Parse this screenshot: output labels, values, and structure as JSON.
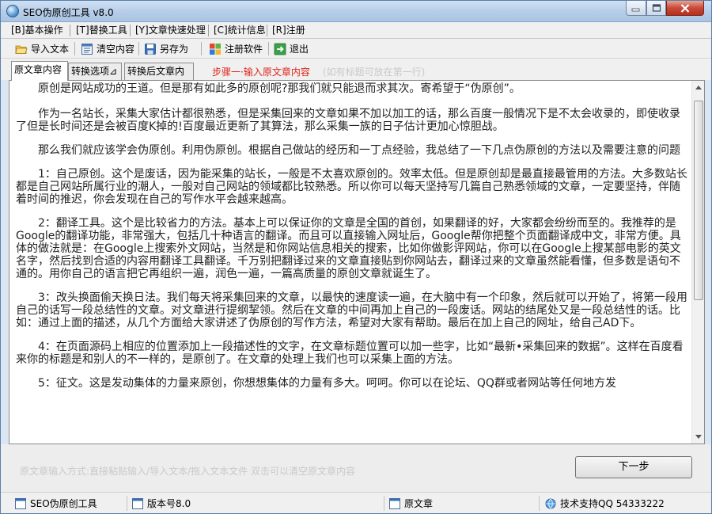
{
  "window": {
    "title": "SEO伪原创工具 v8.0"
  },
  "menu": {
    "items": [
      {
        "label": "[B]基本操作"
      },
      {
        "label": "[T]替换工具"
      },
      {
        "label": "[Y]文章快速处理"
      },
      {
        "label": "[C]统计信息"
      },
      {
        "label": "[R]注册"
      }
    ]
  },
  "toolbar": {
    "import_label": "导入文本",
    "clear_label": "清空内容",
    "save_as_label": "另存为",
    "register_label": "注册软件",
    "exit_label": "退出"
  },
  "tabs": {
    "original": "原文章内容",
    "options": "转换选项⊿",
    "converted": "转换后文章内容"
  },
  "step": {
    "label": "步骤一·输入原文章内容",
    "hint": "(如有标题可放在第一行)"
  },
  "article": {
    "paragraphs": [
      "原创是网站成功的王道。但是那有如此多的原创呢?那我们就只能退而求其次。寄希望于“伪原创”。",
      "作为一名站长，采集大家估计都很熟悉，但是采集回来的文章如果不加以加工的话，那么百度一般情况下是不太会收录的，即使收录了但是长时间还是会被百度K掉的!百度最近更新了其算法，那么采集一族的日子估计更加心惊胆战。",
      "那么我们就应该学会伪原创。利用伪原创。根据自己做站的经历和一丁点经验，我总结了一下几点伪原创的方法以及需要注意的问题",
      "1：自己原创。这个是废话，因为能采集的站长，一般是不太喜欢原创的。效率太低。但是原创却是最直接最管用的方法。大多数站长都是自己网站所属行业的潮人，一般对自己网站的领域都比较熟悉。所以你可以每天坚持写几篇自己熟悉领域的文章，一定要坚持，伴随着时间的推迟，你会发现在自己的写作水平会越来越高。",
      "2：翻译工具。这个是比较省力的方法。基本上可以保证你的文章是全国的首创，如果翻译的好，大家都会纷纷而至的。我推荐的是Google的翻译功能，非常强大，包括几十种语言的翻译。而且可以直接输入网址后，Google帮你把整个页面翻译成中文，非常方便。具体的做法就是：在Google上搜索外文网站，当然是和你网站信息相关的搜索，比如你做影评网站，你可以在Google上搜某部电影的英文名字，然后找到合适的内容用翻译工具翻译。千万别把翻译过来的文章直接贴到你网站去，翻译过来的文章虽然能看懂，但多数是语句不通的。用你自己的语言把它再组织一遍，润色一遍，一篇高质量的原创文章就诞生了。",
      "3：改头换面偷天换日法。我们每天将采集回来的文章，以最快的速度读一遍，在大脑中有一个印象，然后就可以开始了，将第一段用自己的话写一段总结性的文章。对文章进行提纲挈领。然后在文章的中间再加上自己的一段废话。网站的结尾处又是一段总结性的话。比如：通过上面的描述，从几个方面给大家讲述了伪原创的写作方法，希望对大家有帮助。最后在加上自己的网址，给自己AD下。",
      "4：在页面源码上相应的位置添加上一段描述性的文字，在文章标题位置可以加一些字，比如“最新•采集回来的数据”。这样在百度看来你的标题是和别人的不一样的，是原创了。在文章的处理上我们也可以采集上面的方法。",
      "5：征文。这是发动集体的力量来原创，你想想集体的力量有多大。呵呵。你可以在论坛、QQ群或者网站等任何地方发"
    ]
  },
  "bottom": {
    "input_hint": "原文章输入方式:直接粘贴输入/导入文本/拖入文本文件 双击可以清空原文章内容",
    "next_label": "下一步"
  },
  "status": {
    "app_name": "SEO伪原创工具",
    "version": "版本号8.0",
    "mode": "原文章",
    "support": "技术支持QQ 54333222"
  },
  "colors": {
    "step_red": "#e0241b",
    "hint_gray": "#c9c9c9",
    "window_blue": "#b5cde8"
  },
  "icons": {
    "app": "app-logo-icon",
    "import": "folder-open-icon",
    "clear": "clear-document-icon",
    "save": "save-disk-icon",
    "register": "register-windows-icon",
    "exit": "exit-arrow-icon"
  }
}
